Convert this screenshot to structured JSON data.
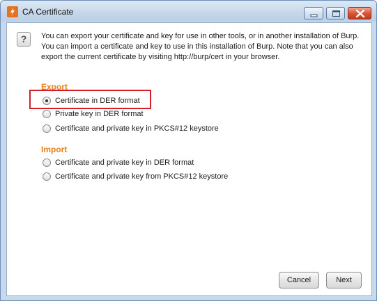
{
  "window": {
    "title": "CA Certificate",
    "icons": {
      "app": "burp-app-icon",
      "minimize": "minimize-icon",
      "maximize": "maximize-icon",
      "close": "close-icon",
      "help": "help-icon"
    }
  },
  "intro": {
    "line1": "You can export your certificate and key for use in other tools, or in another installation of Burp.",
    "line2": "You can import a certificate and key to use in this installation of Burp. Note that you can also",
    "line3": "export the current certificate by visiting http://burp/cert in your browser."
  },
  "help_glyph": "?",
  "export": {
    "heading": "Export",
    "options": [
      {
        "label": "Certificate in DER format",
        "selected": true
      },
      {
        "label": "Private key in DER format",
        "selected": false
      },
      {
        "label": "Certificate and private key in PKCS#12 keystore",
        "selected": false
      }
    ]
  },
  "import": {
    "heading": "Import",
    "options": [
      {
        "label": "Certificate and private key in DER format",
        "selected": false
      },
      {
        "label": "Certificate and private key from PKCS#12 keystore",
        "selected": false
      }
    ]
  },
  "buttons": {
    "cancel": "Cancel",
    "next": "Next"
  },
  "colors": {
    "section_heading": "#e8801b",
    "highlight_box": "#d21f2b",
    "accent_icon": "#e8731e"
  }
}
